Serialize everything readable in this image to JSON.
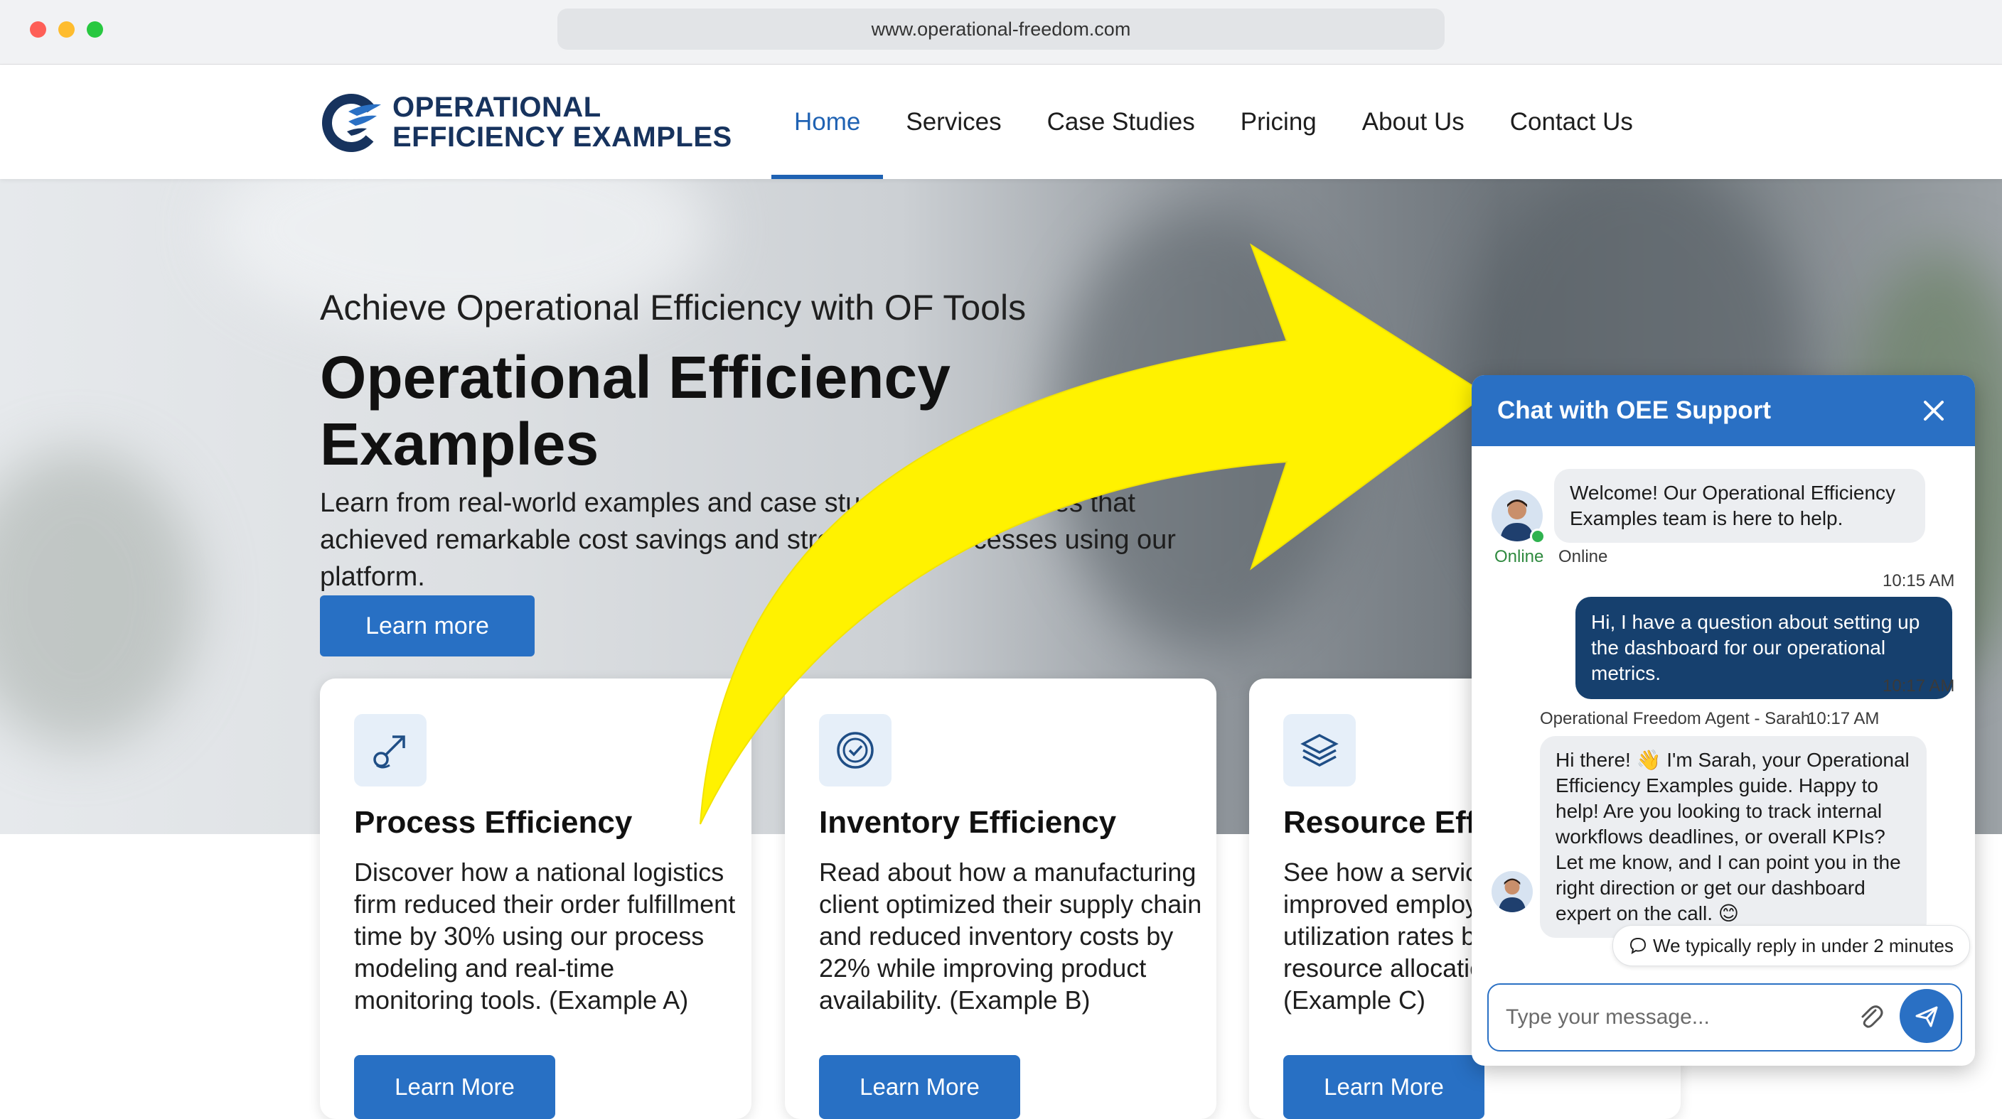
{
  "browser": {
    "url": "www.operational-freedom.com"
  },
  "header": {
    "logo_line1": "OPERATIONAL",
    "logo_line2": "EFFICIENCY EXAMPLES",
    "nav": [
      {
        "label": "Home",
        "active": true
      },
      {
        "label": "Services"
      },
      {
        "label": "Case Studies"
      },
      {
        "label": "Pricing"
      },
      {
        "label": "About Us"
      },
      {
        "label": "Contact Us"
      }
    ]
  },
  "hero": {
    "subtitle": "Achieve Operational Efficiency with OF Tools",
    "title": "Operational Efficiency Examples",
    "description": "Learn from real-world examples and case studies of businesses that achieved remarkable cost savings and streamlined processes using our platform.",
    "cta_label": "Learn more"
  },
  "cards": [
    {
      "icon": "process-flow-icon",
      "title": "Process Efficiency",
      "text": "Discover how a national logistics firm reduced their order fulfillment time by 30% using our process modeling and real-time monitoring tools. (Example A)",
      "button": "Learn More"
    },
    {
      "icon": "check-circle-icon",
      "title": "Inventory Efficiency",
      "text": "Read about how a manufacturing client optimized their supply chain and reduced inventory costs by 22% while improving product availability. (Example B)",
      "button": "Learn More"
    },
    {
      "icon": "layers-icon",
      "title": "Resource Effi",
      "text": "See how a service improved employs utilization rates by resource allocatic (Example C)",
      "button": "Learn More"
    }
  ],
  "chat": {
    "title": "Chat with OEE Support",
    "welcome": "Welcome! Our Operational Efficiency Examples team is here to help.",
    "agent_status": "Online",
    "status_label": "Online",
    "time_1": "10:15 AM",
    "user_message": "Hi, I have a question about setting up the dashboard for our operational metrics.",
    "time_2": "10:17 AM",
    "agent_label": "Operational Freedom Agent - Sarah",
    "agent_time": "10:17 AM",
    "agent_message": "Hi there! 👋 I'm Sarah, your Operational Efficiency Examples guide. Happy to help! Are you looking to track internal workflows deadlines, or overall KPIs? Let me know, and I can point you in the right direction or get our dashboard expert on the call. 😊",
    "reply_notice": "We typically reply in under 2 minutes",
    "input_placeholder": "Type your message..."
  },
  "colors": {
    "brand_blue": "#2870c4",
    "navy": "#17335e",
    "chat_out_bubble": "#16406e",
    "arrow_yellow": "#fff200"
  }
}
